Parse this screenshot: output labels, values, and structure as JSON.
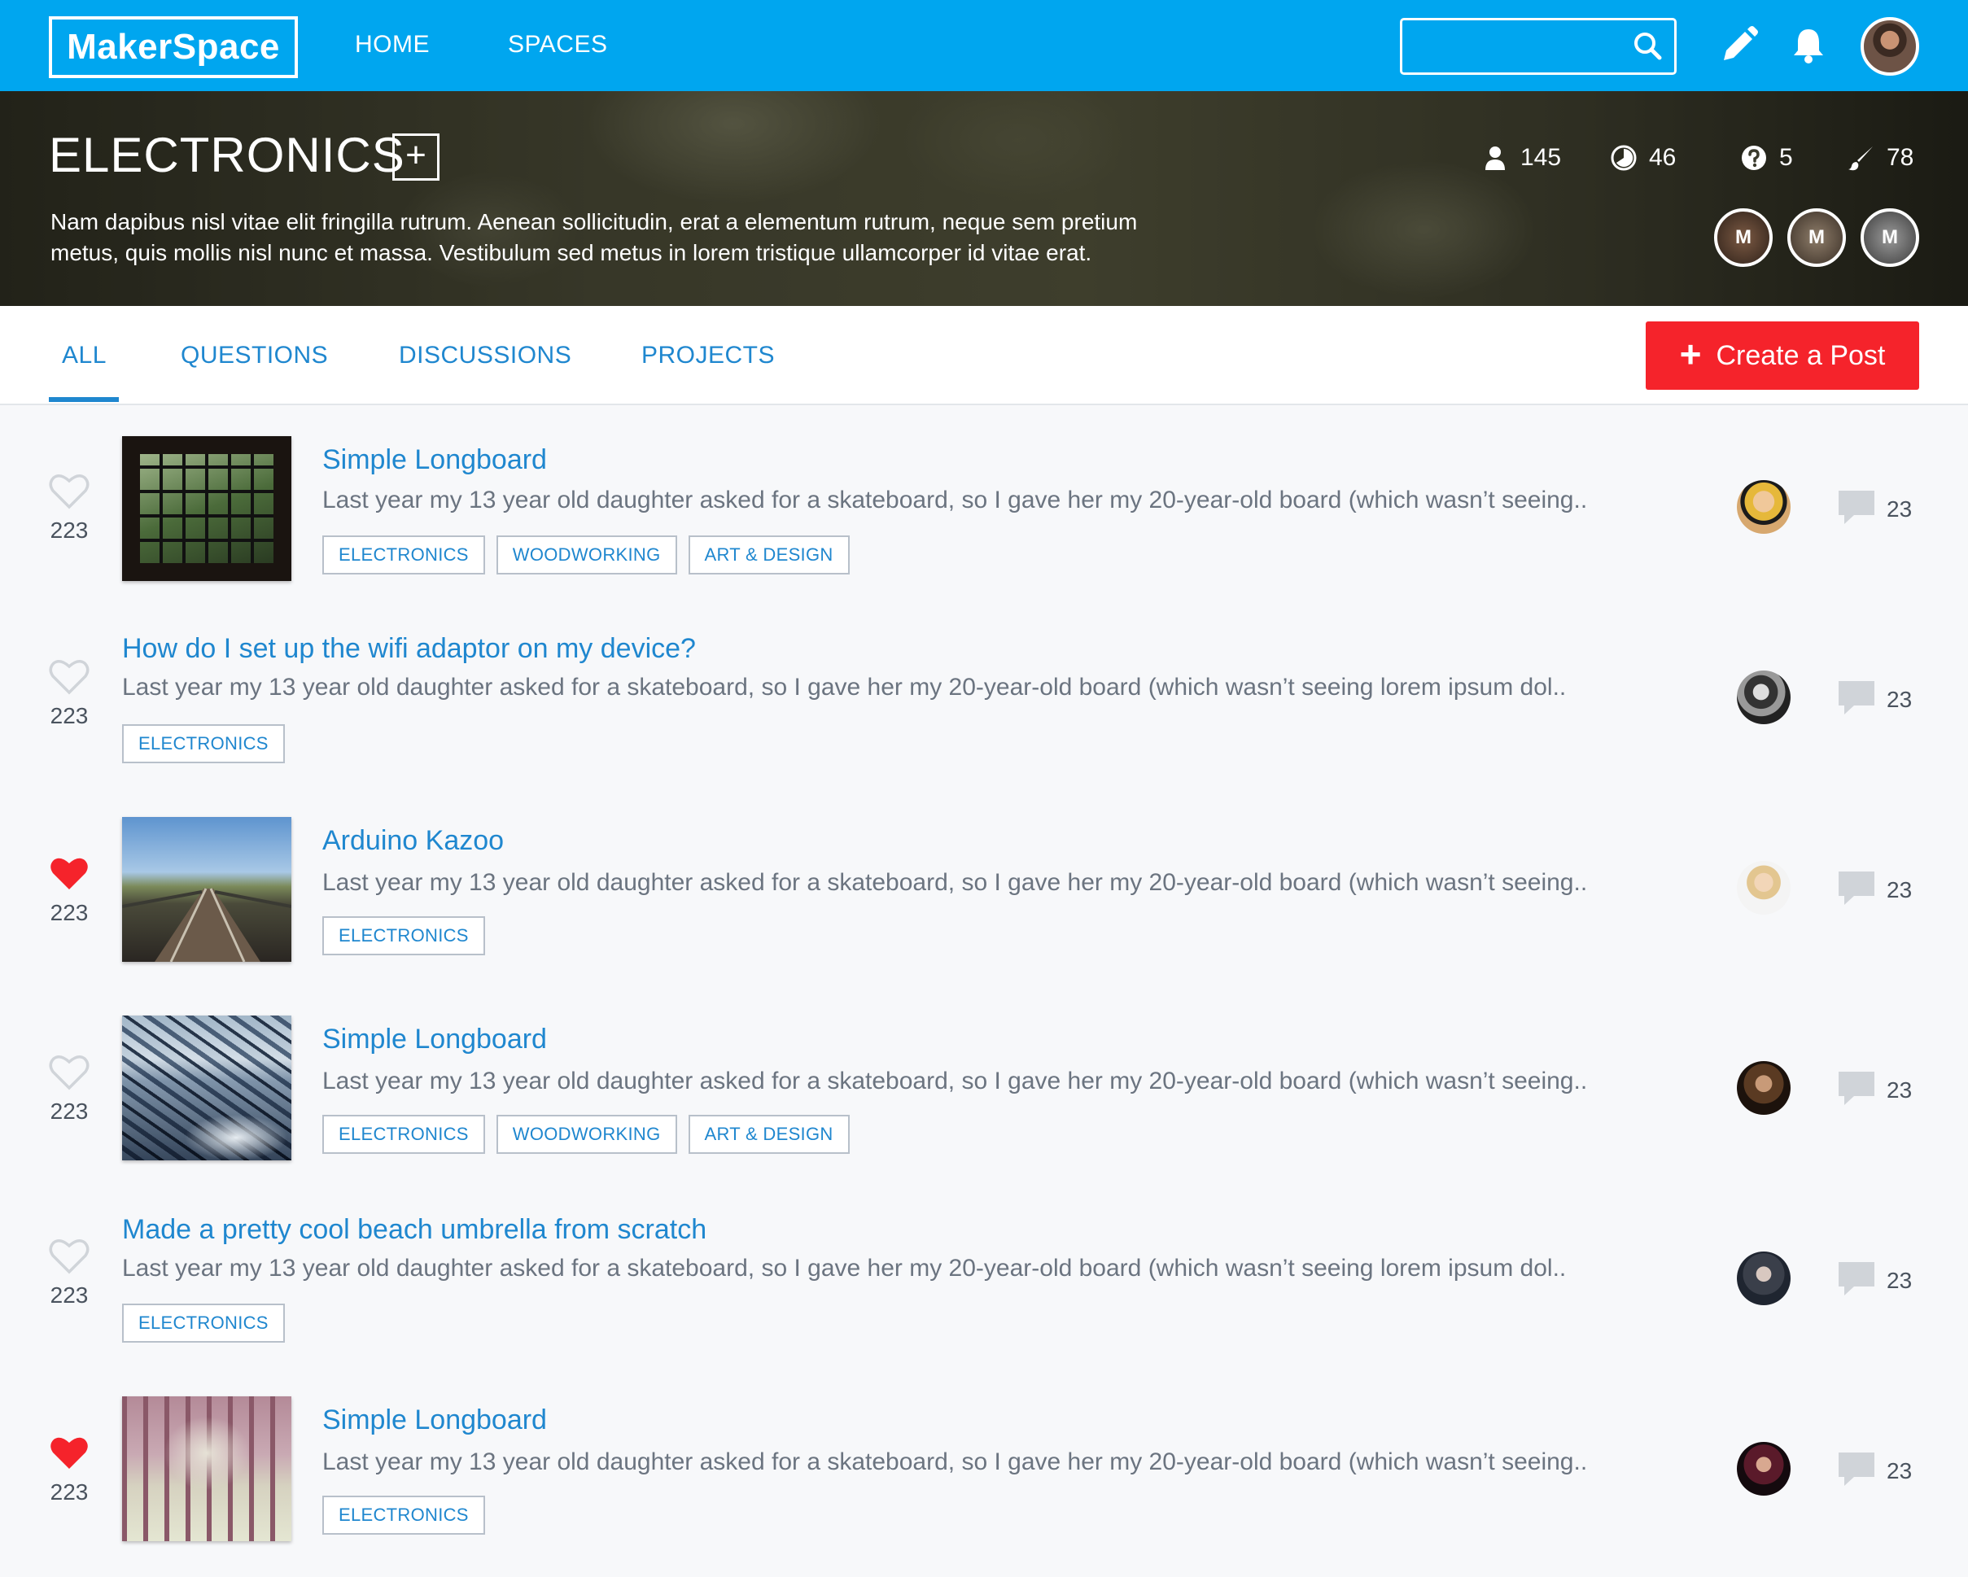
{
  "nav": {
    "logo": "MakerSpace",
    "links": [
      "HOME",
      "SPACES"
    ],
    "search": {
      "value": "",
      "placeholder": ""
    }
  },
  "space": {
    "title": "ELECTRONICS",
    "add_symbol": "+",
    "description_line1": "Nam dapibus nisl vitae elit fringilla rutrum. Aenean sollicitudin, erat a elementum rutrum, neque sem pretium",
    "description_line2": "metus, quis mollis nisl nunc et massa. Vestibulum sed metus in lorem tristique ullamcorper id vitae erat.",
    "stats": {
      "members": "145",
      "activity": "46",
      "questions": "5",
      "posts": "78"
    },
    "moderators": [
      "M",
      "M",
      "M"
    ]
  },
  "tabs": {
    "all": "ALL",
    "questions": "QUESTIONS",
    "discussions": "DISCUSSIONS",
    "projects": "PROJECTS",
    "active": "ALL"
  },
  "create_button": {
    "plus": "+",
    "label": "Create a Post"
  },
  "posts": [
    {
      "title": "Simple Longboard",
      "excerpt": "Last year my 13 year old daughter asked for a skateboard, so I gave her my 20-year-old board (which wasn’t seeing..",
      "tags": [
        "ELECTRONICS",
        "WOODWORKING",
        "ART & DESIGN"
      ],
      "likes": "223",
      "liked": false,
      "comments": "23",
      "thumbnail": "window"
    },
    {
      "title": "How do I set up the wifi adaptor on my device?",
      "excerpt": "Last year my 13 year old daughter asked for a skateboard, so I gave her my 20-year-old board (which wasn’t seeing lorem ipsum dol..",
      "tags": [
        "ELECTRONICS"
      ],
      "likes": "223",
      "liked": false,
      "comments": "23",
      "thumbnail": ""
    },
    {
      "title": "Arduino Kazoo",
      "excerpt": "Last year my 13 year old daughter asked for a skateboard, so I gave her my 20-year-old board (which wasn’t seeing..",
      "tags": [
        "ELECTRONICS"
      ],
      "likes": "223",
      "liked": true,
      "comments": "23",
      "thumbnail": "railway"
    },
    {
      "title": "Simple Longboard",
      "excerpt": "Last year my 13 year old daughter asked for a skateboard, so I gave her my 20-year-old board (which wasn’t seeing..",
      "tags": [
        "ELECTRONICS",
        "WOODWORKING",
        "ART & DESIGN"
      ],
      "likes": "223",
      "liked": false,
      "comments": "23",
      "thumbnail": "snowy-town"
    },
    {
      "title": "Made a pretty cool beach umbrella from scratch",
      "excerpt": "Last year my 13 year old daughter asked for a skateboard, so I gave her my 20-year-old board (which wasn’t seeing lorem ipsum dol..",
      "tags": [
        "ELECTRONICS"
      ],
      "likes": "223",
      "liked": false,
      "comments": "23",
      "thumbnail": ""
    },
    {
      "title": "Simple Longboard",
      "excerpt": "Last year my 13 year old daughter asked for a skateboard, so I gave her my 20-year-old board (which wasn’t seeing..",
      "tags": [
        "ELECTRONICS"
      ],
      "likes": "223",
      "liked": true,
      "comments": "23",
      "thumbnail": "foggy-forest"
    }
  ],
  "colors": {
    "brand": "#00a6ef",
    "link": "#1f87cf",
    "create": "#f5232b",
    "liked": "#f5232b",
    "unliked": "#d0d4d9"
  }
}
